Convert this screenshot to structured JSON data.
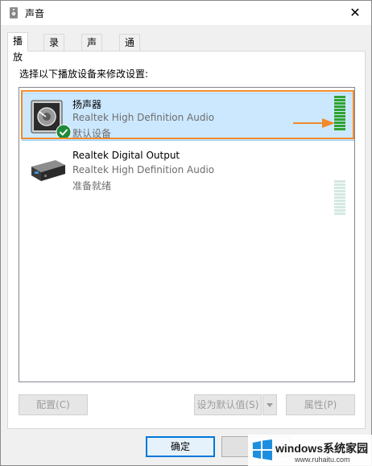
{
  "window": {
    "title": "声音",
    "close_glyph": "✕"
  },
  "tabs": [
    {
      "label": "播放",
      "active": true
    },
    {
      "label": "录制",
      "active": false
    },
    {
      "label": "声音",
      "active": false
    },
    {
      "label": "通信",
      "active": false
    }
  ],
  "panel": {
    "instruction": "选择以下播放设备来修改设置:"
  },
  "devices": [
    {
      "name": "扬声器",
      "description": "Realtek High Definition Audio",
      "status": "默认设备",
      "icon": "speaker-icon",
      "selected": true,
      "meter_level": 1.0
    },
    {
      "name": "Realtek Digital Output",
      "description": "Realtek High Definition Audio",
      "status": "准备就绪",
      "icon": "digital-output-icon",
      "selected": false,
      "meter_level": 0.0
    }
  ],
  "buttons": {
    "configure": "配置(C)",
    "set_default": "设为默认值(S)",
    "properties": "属性(P)",
    "ok": "确定",
    "cancel": "取"
  },
  "watermark": {
    "brand": "windows系统家园",
    "url": "www.ruhaitu.com"
  },
  "colors": {
    "accent": "#0078d7",
    "highlight": "#ef8a2c",
    "meter_active": "#2fa32f",
    "meter_idle": "#d4e9e0",
    "selection": "#cce8ff"
  }
}
